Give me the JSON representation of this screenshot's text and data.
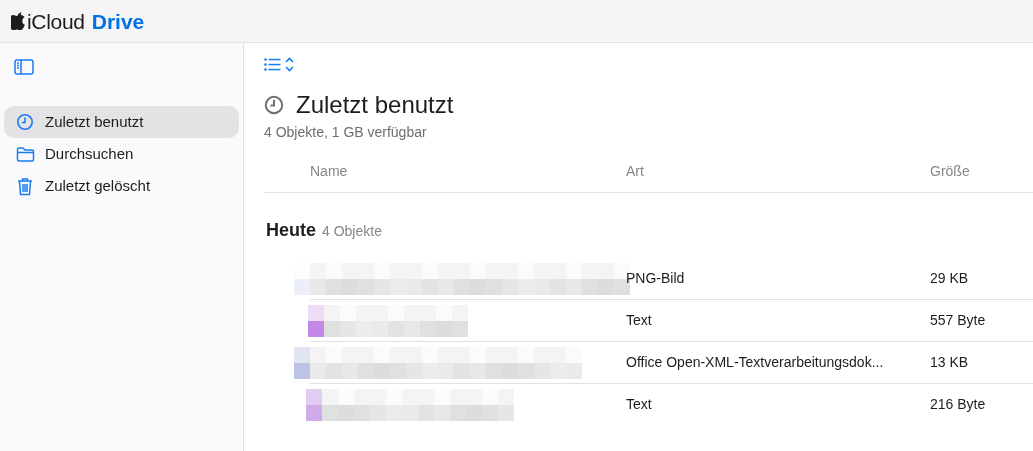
{
  "header": {
    "brand": "iCloud",
    "product": "Drive"
  },
  "sidebar": {
    "items": [
      {
        "label": "Zuletzt benutzt",
        "kind": "clock",
        "selected": true
      },
      {
        "label": "Durchsuchen",
        "kind": "folder",
        "selected": false
      },
      {
        "label": "Zuletzt gelöscht",
        "kind": "trash",
        "selected": false
      }
    ]
  },
  "main": {
    "title": "Zuletzt benutzt",
    "subtitle": "4 Objekte, 1 GB verfügbar",
    "table": {
      "columns": [
        "Name",
        "Art",
        "Größe"
      ],
      "group": {
        "title": "Heute",
        "count": "4 Objekte"
      },
      "rows": [
        {
          "type": "PNG-Bild",
          "size": "29 KB"
        },
        {
          "type": "Text",
          "size": "557 Byte"
        },
        {
          "type": "Office Open-XML-Textverarbeitungsdok...",
          "size": "13 KB"
        },
        {
          "type": "Text",
          "size": "216 Byte"
        }
      ]
    }
  }
}
